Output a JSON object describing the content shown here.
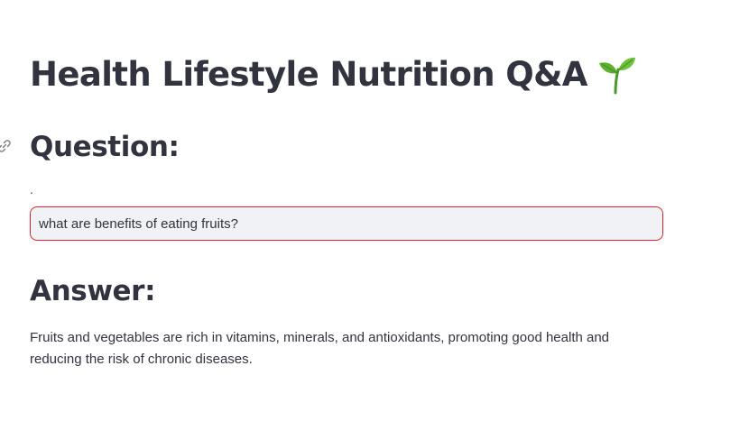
{
  "header": {
    "title": "Health Lifestyle Nutrition Q&A",
    "title_icon": "seedling-icon"
  },
  "question": {
    "heading": "Question:",
    "heading_icon": "link-icon",
    "input_label": ".",
    "input_value": "what are benefits of eating fruits?"
  },
  "answer": {
    "heading": "Answer:",
    "text": "Fruits and vegetables are rich in vitamins, minerals, and antioxidants, promoting good health and reducing the risk of chronic diseases."
  },
  "colors": {
    "text": "#31333f",
    "input_border_focus": "#e0212d",
    "input_background": "#f0f2f6",
    "sprout_green": "#5fb030"
  }
}
